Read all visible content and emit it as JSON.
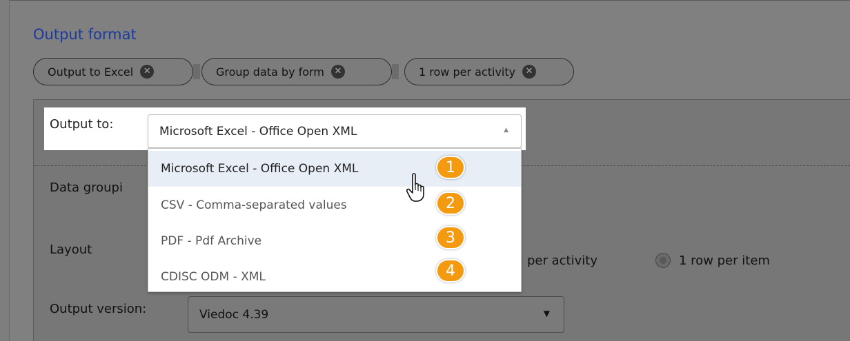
{
  "section_title": "Output format",
  "chips": [
    {
      "label": "Output to Excel"
    },
    {
      "label": "Group data by form"
    },
    {
      "label": "1 row per activity"
    }
  ],
  "output_to": {
    "label": "Output to:",
    "selected": "Microsoft Excel - Office Open XML",
    "options": [
      {
        "label": "Microsoft Excel - Office Open XML",
        "badge": "1"
      },
      {
        "label": "CSV - Comma-separated values",
        "badge": "2"
      },
      {
        "label": "PDF - Pdf Archive",
        "badge": "3"
      },
      {
        "label": "CDISC ODM - XML",
        "badge": "4"
      }
    ]
  },
  "data_grouping": {
    "label_partial": "Data groupi"
  },
  "layout": {
    "label": "Layout",
    "option_activity_partial": "per activity",
    "option_item": "1 row per item"
  },
  "output_version": {
    "label": "Output version:",
    "value": "Viedoc 4.39"
  },
  "icons": {
    "chip_remove": "close-circle-icon",
    "select_up": "caret-up-icon",
    "select_down": "caret-down-icon",
    "cursor": "hand-pointer-icon"
  },
  "colors": {
    "title": "#1b3a9e",
    "badge": "#f39a10",
    "selected_row": "#e8eef6"
  }
}
